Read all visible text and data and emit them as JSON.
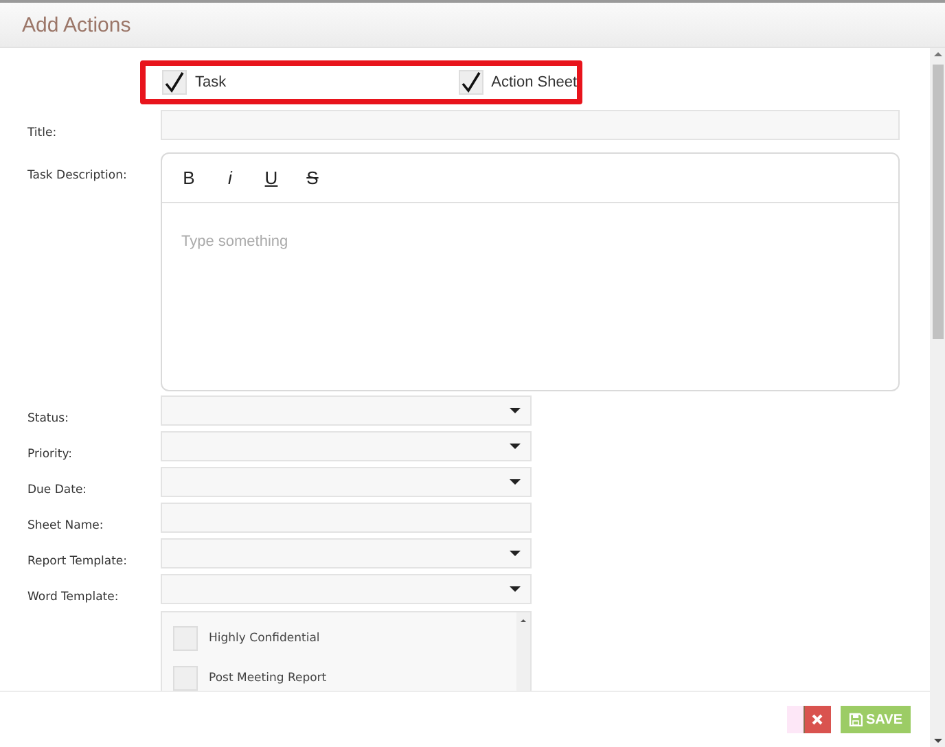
{
  "window": {
    "title": "Add Actions"
  },
  "types": [
    {
      "label": "Task",
      "checked": true
    },
    {
      "label": "Action Sheet",
      "checked": true
    }
  ],
  "fields": [
    {
      "label": "Title:",
      "kind": "text"
    },
    {
      "label": "Task Description:",
      "kind": "editor",
      "placeholder": "Type something",
      "toolbar": [
        {
          "label": "B",
          "kind": "bold"
        },
        {
          "label": "i",
          "kind": "italic"
        },
        {
          "label": "U",
          "kind": "underline"
        },
        {
          "label": "S",
          "kind": "strike"
        }
      ]
    },
    {
      "label": "Status:",
      "kind": "select"
    },
    {
      "label": "Priority:",
      "kind": "select"
    },
    {
      "label": "Due Date:",
      "kind": "select"
    },
    {
      "label": "Sheet Name:",
      "kind": "short"
    },
    {
      "label": "Report Template:",
      "kind": "select"
    },
    {
      "label": "Word Template:",
      "kind": "select"
    },
    {
      "kind": "list",
      "items": [
        {
          "label": "Highly Confidential",
          "checked": false
        },
        {
          "label": "Post Meeting Report",
          "checked": false
        }
      ]
    }
  ],
  "footer": {
    "save": "SAVE"
  }
}
